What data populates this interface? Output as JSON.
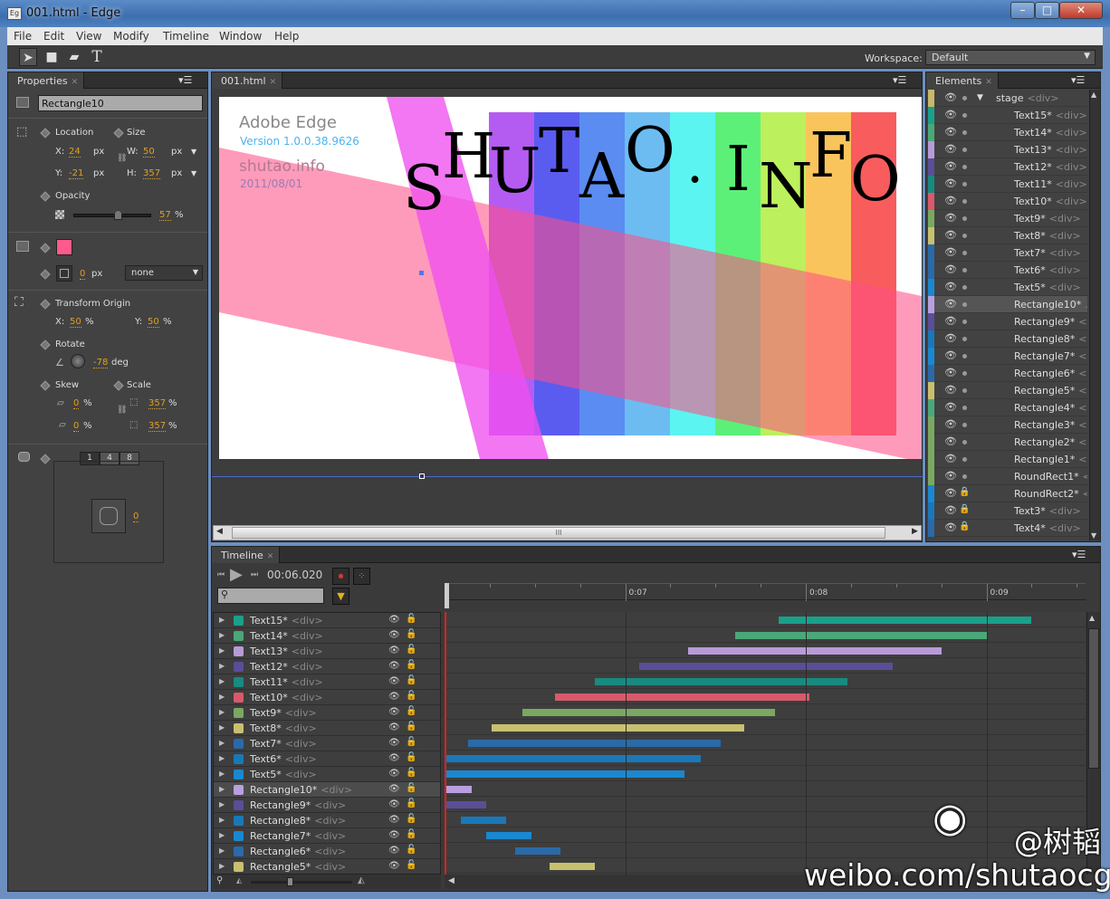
{
  "window": {
    "title": "001.html - Edge",
    "icon_text": "Eg",
    "buttons": [
      "–",
      "□",
      "✕"
    ]
  },
  "menu": [
    "File",
    "Edit",
    "View",
    "Modify",
    "Timeline",
    "Window",
    "Help"
  ],
  "toolbar": {
    "tools": [
      "select-tool",
      "rectangle-tool",
      "rounded-rectangle-tool",
      "text-tool"
    ],
    "tool_glyphs": [
      "➤",
      "■",
      "▰",
      "T"
    ],
    "workspace_label": "Workspace:",
    "workspace_value": "Default"
  },
  "properties": {
    "tab": "Properties",
    "element_name": "Rectangle10",
    "location_label": "Location",
    "size_label": "Size",
    "x_label": "X:",
    "x": "24",
    "y_label": "Y:",
    "y": "-21",
    "w_label": "W:",
    "w": "50",
    "h_label": "H:",
    "h": "357",
    "unit_px": "px",
    "opacity_label": "Opacity",
    "opacity": "57",
    "opacity_fraction": 0.57,
    "pct": "%",
    "fill_color": "#ff5a8a",
    "border_width": "0",
    "border_style": "none",
    "transform_origin_label": "Transform Origin",
    "origin_x": "50",
    "origin_y": "50",
    "rotate_label": "Rotate",
    "rotate": "-78",
    "deg": "deg",
    "skew_label": "Skew",
    "skew_x": "0",
    "skew_y": "0",
    "scale_label": "Scale",
    "scale_x": "357",
    "scale_y": "357",
    "corner_tabs": [
      "1",
      "4",
      "8"
    ],
    "corner_radius": "0"
  },
  "stage": {
    "tab": "001.html",
    "title": "Adobe Edge",
    "version": "Version 1.0.0.38.9626",
    "site": "shutao.info",
    "date": "2011/08/01",
    "logo_letters": [
      "S",
      "H",
      "U",
      "T",
      "A",
      "O",
      ".",
      "I",
      "N",
      "F",
      "O"
    ],
    "rainbow": [
      "#b45cf2",
      "#5a5cf0",
      "#5a8cf2",
      "#6cbcf2",
      "#5cf4f0",
      "#5cf078",
      "#bcf05c",
      "#fac45c",
      "#f85c5c"
    ],
    "scroll_grip": "III"
  },
  "elements": {
    "tab": "Elements",
    "items": [
      {
        "name": "stage",
        "tag": "<div>",
        "color": "#c8b86a",
        "root": true
      },
      {
        "name": "Text15*",
        "tag": "<div>",
        "color": "#1aa08a"
      },
      {
        "name": "Text14*",
        "tag": "<div>",
        "color": "#4aa878"
      },
      {
        "name": "Text13*",
        "tag": "<div>",
        "color": "#b89ad8"
      },
      {
        "name": "Text12*",
        "tag": "<div>",
        "color": "#5a4e98"
      },
      {
        "name": "Text11*",
        "tag": "<div>",
        "color": "#188a80"
      },
      {
        "name": "Text10*",
        "tag": "<div>",
        "color": "#d85a6a"
      },
      {
        "name": "Text9*",
        "tag": "<div>",
        "color": "#7aa860"
      },
      {
        "name": "Text8*",
        "tag": "<div>",
        "color": "#c8c070"
      },
      {
        "name": "Text7*",
        "tag": "<div>",
        "color": "#2a6aa8"
      },
      {
        "name": "Text6*",
        "tag": "<div>",
        "color": "#2a6aa8"
      },
      {
        "name": "Text5*",
        "tag": "<div>",
        "color": "#1a88d0"
      },
      {
        "name": "Rectangle10*",
        "tag": "...",
        "color": "#b8a0e0",
        "selected": true
      },
      {
        "name": "Rectangle9*",
        "tag": "<...",
        "color": "#5a4e98"
      },
      {
        "name": "Rectangle8*",
        "tag": "<...",
        "color": "#1a78b8"
      },
      {
        "name": "Rectangle7*",
        "tag": "<...",
        "color": "#1a88d0"
      },
      {
        "name": "Rectangle6*",
        "tag": "<...",
        "color": "#2a6aa8"
      },
      {
        "name": "Rectangle5*",
        "tag": "<...",
        "color": "#c8c070"
      },
      {
        "name": "Rectangle4*",
        "tag": "<...",
        "color": "#4aa878"
      },
      {
        "name": "Rectangle3*",
        "tag": "<...",
        "color": "#7aa860"
      },
      {
        "name": "Rectangle2*",
        "tag": "<...",
        "color": "#7aa860"
      },
      {
        "name": "Rectangle1*",
        "tag": "<...",
        "color": "#7aa860"
      },
      {
        "name": "RoundRect1*",
        "tag": "<...",
        "color": "#7aa860"
      },
      {
        "name": "RoundRect2*",
        "tag": "<...",
        "color": "#1a88d0",
        "locked": true
      },
      {
        "name": "Text3*",
        "tag": "<div>",
        "color": "#1a78b8",
        "locked": true
      },
      {
        "name": "Text4*",
        "tag": "<div>",
        "color": "#2a6aa8",
        "locked": true
      }
    ]
  },
  "timeline": {
    "tab": "Timeline",
    "time": "00:06.020",
    "search_placeholder": "",
    "ticks": [
      {
        "label": "0:07",
        "t": 7
      },
      {
        "label": "0:08",
        "t": 8
      },
      {
        "label": "0:09",
        "t": 9
      }
    ],
    "view_start": 6.0,
    "playhead": 6.0,
    "rows": [
      {
        "name": "Text15*",
        "tag": "<div>",
        "color": "#1aa08a",
        "start": 7.85,
        "end": 9.25
      },
      {
        "name": "Text14*",
        "tag": "<div>",
        "color": "#4aa878",
        "start": 7.61,
        "end": 9.01
      },
      {
        "name": "Text13*",
        "tag": "<div>",
        "color": "#b89ad8",
        "start": 7.35,
        "end": 8.75
      },
      {
        "name": "Text12*",
        "tag": "<div>",
        "color": "#5a4e98",
        "start": 7.08,
        "end": 8.48
      },
      {
        "name": "Text11*",
        "tag": "<div>",
        "color": "#188a80",
        "start": 6.83,
        "end": 8.23
      },
      {
        "name": "Text10*",
        "tag": "<div>",
        "color": "#d85a6a",
        "start": 6.61,
        "end": 8.02
      },
      {
        "name": "Text9*",
        "tag": "<div>",
        "color": "#7aa860",
        "start": 6.43,
        "end": 7.83
      },
      {
        "name": "Text8*",
        "tag": "<div>",
        "color": "#c8c070",
        "start": 6.26,
        "end": 7.66
      },
      {
        "name": "Text7*",
        "tag": "<div>",
        "color": "#2a6aa8",
        "start": 6.13,
        "end": 7.53
      },
      {
        "name": "Text6*",
        "tag": "<div>",
        "color": "#1a78b8",
        "start": 6.01,
        "end": 7.42
      },
      {
        "name": "Text5*",
        "tag": "<div>",
        "color": "#1a88d0",
        "start": 6.0,
        "end": 7.33
      },
      {
        "name": "Rectangle10*",
        "tag": "<div>",
        "color": "#b8a0e0",
        "start": 6.0,
        "end": 6.15,
        "selected": true
      },
      {
        "name": "Rectangle9*",
        "tag": "<div>",
        "color": "#5a4e98",
        "start": 6.0,
        "end": 6.23
      },
      {
        "name": "Rectangle8*",
        "tag": "<div>",
        "color": "#1a78b8",
        "start": 6.09,
        "end": 6.34
      },
      {
        "name": "Rectangle7*",
        "tag": "<div>",
        "color": "#1a88d0",
        "start": 6.23,
        "end": 6.48
      },
      {
        "name": "Rectangle6*",
        "tag": "<div>",
        "color": "#2a6aa8",
        "start": 6.39,
        "end": 6.64
      },
      {
        "name": "Rectangle5*",
        "tag": "<div>",
        "color": "#c8c070",
        "start": 6.58,
        "end": 6.83
      }
    ]
  },
  "watermark": {
    "handle": "@树韬",
    "url": "weibo.com/shutaocg"
  }
}
